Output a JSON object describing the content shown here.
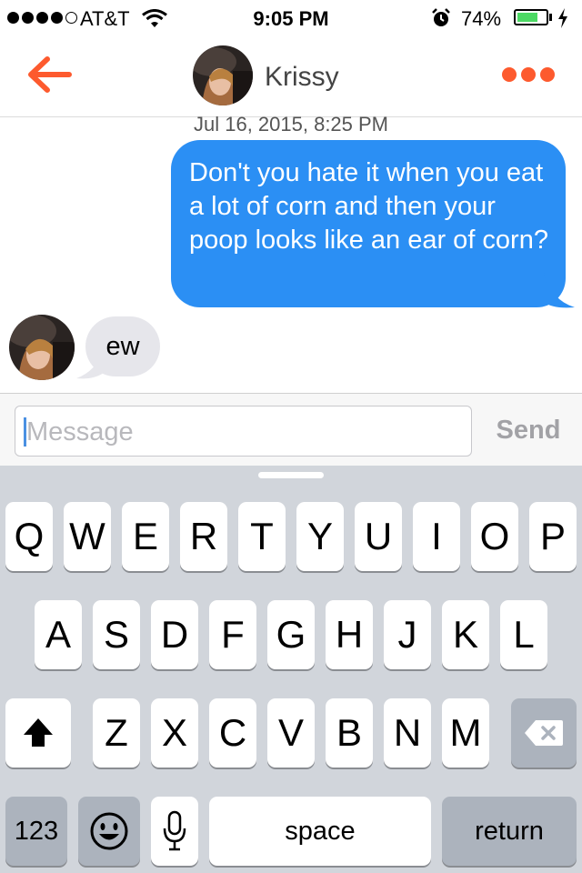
{
  "status_bar": {
    "carrier": "AT&T",
    "time": "9:05 PM",
    "battery_percent": "74%",
    "battery_level": 0.74,
    "signal_bars": 4,
    "signal_max": 5
  },
  "nav": {
    "contact_name": "Krissy",
    "back_icon": "back-arrow-icon",
    "more_icon": "more-options-icon",
    "accent_color": "#fd5a2e"
  },
  "conversation": {
    "timestamp": "Jul 16, 2015, 8:25 PM",
    "messages": [
      {
        "direction": "outgoing",
        "text": "Don't you hate it when you eat a lot of corn and then your poop looks like an ear of corn?"
      },
      {
        "direction": "incoming",
        "text": "ew"
      }
    ],
    "outgoing_color": "#2b8ff4",
    "incoming_color": "#e6e6eb"
  },
  "input": {
    "placeholder": "Message",
    "value": "",
    "send_label": "Send"
  },
  "keyboard": {
    "row1": [
      "Q",
      "W",
      "E",
      "R",
      "T",
      "Y",
      "U",
      "I",
      "O",
      "P"
    ],
    "row2": [
      "A",
      "S",
      "D",
      "F",
      "G",
      "H",
      "J",
      "K",
      "L"
    ],
    "row3": [
      "Z",
      "X",
      "C",
      "V",
      "B",
      "N",
      "M"
    ],
    "numbers_label": "123",
    "space_label": "space",
    "return_label": "return",
    "shift_icon": "shift-icon",
    "delete_icon": "delete-icon",
    "emoji_icon": "emoji-icon",
    "mic_icon": "microphone-icon"
  }
}
